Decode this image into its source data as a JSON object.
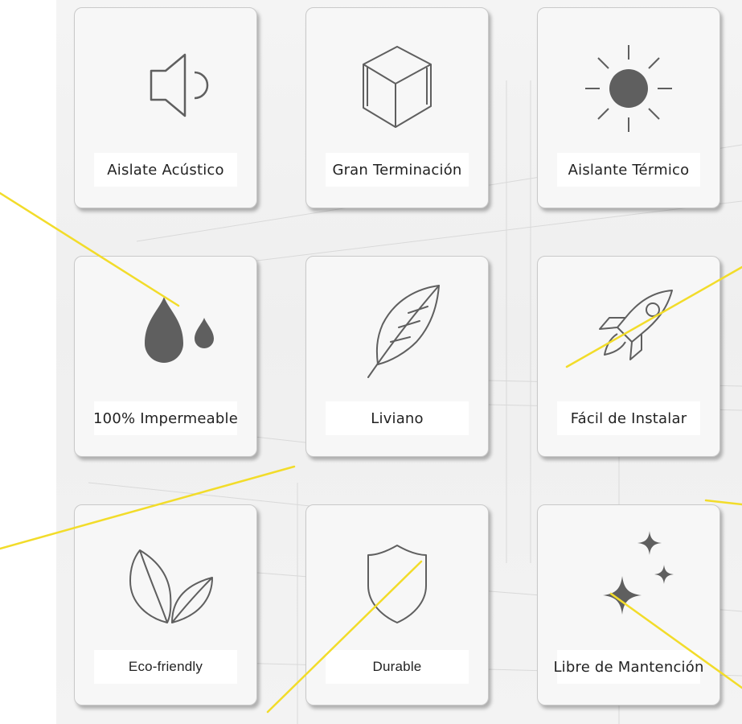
{
  "features": [
    {
      "label": "Aislate Acústico",
      "icon": "speaker-icon"
    },
    {
      "label": "Gran Terminación",
      "icon": "cube-icon"
    },
    {
      "label": "Aislante Térmico",
      "icon": "sun-icon"
    },
    {
      "label": "100% Impermeable",
      "icon": "water-drops-icon"
    },
    {
      "label": "Liviano",
      "icon": "feather-icon"
    },
    {
      "label": "Fácil de Instalar",
      "icon": "rocket-icon"
    },
    {
      "label": "Eco-friendly",
      "icon": "leaves-icon"
    },
    {
      "label": "Durable",
      "icon": "shield-icon"
    },
    {
      "label": "Libre de Mantención",
      "icon": "sparkles-icon"
    }
  ],
  "colors": {
    "icon": "#5f5f5f",
    "annotation_line": "#f2dc2a",
    "card_border": "#c9c9c9"
  }
}
